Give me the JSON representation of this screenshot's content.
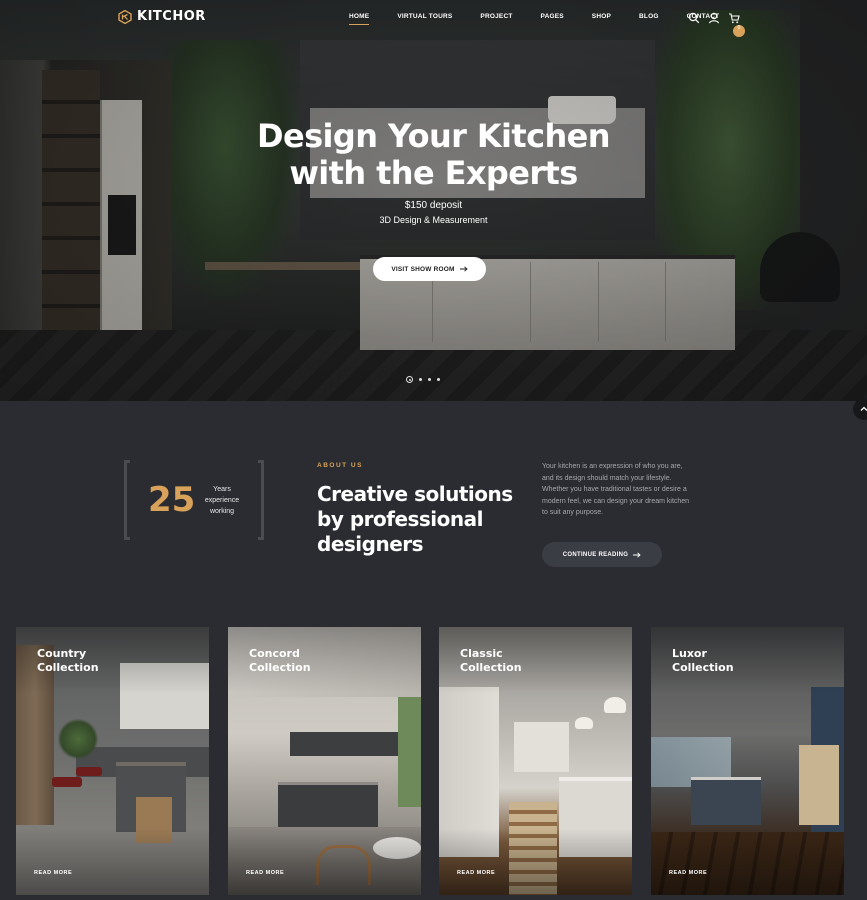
{
  "brand": {
    "name": "KITCHOR"
  },
  "nav": {
    "items": [
      {
        "label": "HOME",
        "active": true
      },
      {
        "label": "VIRTUAL TOURS"
      },
      {
        "label": "PROJECT"
      },
      {
        "label": "PAGES"
      },
      {
        "label": "SHOP"
      },
      {
        "label": "BLOG"
      },
      {
        "label": "CONTACT"
      }
    ],
    "icons": [
      "search-icon",
      "user-icon",
      "cart-icon"
    ],
    "cart_count": "0"
  },
  "hero": {
    "title_line1": "Design Your Kitchen",
    "title_line2": "with the Experts",
    "deposit": "$150 deposit",
    "service": "3D Design & Measurement",
    "button_label": "VISIT SHOW ROOM",
    "slide_count": 4,
    "active_slide": 1
  },
  "about": {
    "years": "25",
    "years_line1": "Years",
    "years_line2": "experience",
    "years_line3": "working",
    "label": "ABOUT US",
    "title_line1": "Creative solutions",
    "title_line2": "by professional",
    "title_line3": "designers",
    "text_lines": [
      "Your kitchen is an expression of who you are,",
      "and its design should match your lifestyle.",
      "Whether you have traditional tastes or desire a",
      "modern feel, we can design your dream kitchen",
      "to suit any purpose."
    ],
    "button_label": "CONTINUE READING"
  },
  "collections": [
    {
      "line1": "Country",
      "line2": "Collection",
      "link": "READ MORE"
    },
    {
      "line1": "Concord",
      "line2": "Collection",
      "link": "READ MORE"
    },
    {
      "line1": "Classic",
      "line2": "Collection",
      "link": "READ MORE"
    },
    {
      "line1": "Luxor",
      "line2": "Collection",
      "link": "READ MORE"
    }
  ],
  "colors": {
    "accent": "#d9a25a",
    "background": "#2a2c31",
    "button_dark": "#3a3d43"
  }
}
